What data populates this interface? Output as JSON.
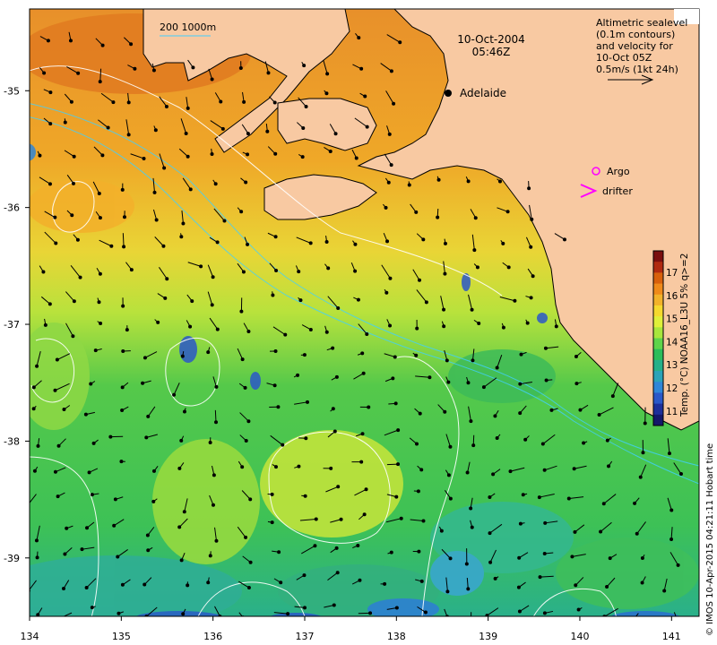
{
  "title": {
    "date": "10-Oct-2004",
    "time": "05:46Z"
  },
  "contour_legend": "200  1000m",
  "city": "Adelaide",
  "altimetry_note": {
    "lines": [
      "Altimetric sealevel",
      "(0.1m contours)",
      "and velocity for",
      "10-Oct 05Z",
      "0.5m/s (1kt 24h)"
    ]
  },
  "legend_items": {
    "argo": "Argo",
    "drifter": "drifter"
  },
  "colorbar": {
    "title": "Temp. (°C) NOAA16_L3U 5% q>=2",
    "ticks": [
      "17",
      "16",
      "15",
      "14",
      "13",
      "12",
      "11"
    ],
    "colors": [
      "#7a0f0f",
      "#b02a10",
      "#d8600c",
      "#ef8a1a",
      "#f2b22a",
      "#f5d92e",
      "#dff03a",
      "#a8e63c",
      "#5ed44a",
      "#2bbd5a",
      "#24b08a",
      "#2aa3b8",
      "#2f86d8",
      "#2b58c8",
      "#1e2f9a",
      "#14186a"
    ]
  },
  "credit": "© IMOS 10-Apr-2015 04:21:11 Hobart time",
  "axes": {
    "x_ticks": [
      "134",
      "135",
      "136",
      "137",
      "138",
      "139",
      "140",
      "141"
    ],
    "y_ticks": [
      "-35",
      "-36",
      "-37",
      "-38",
      "-39"
    ],
    "lon_range": [
      134,
      141.3
    ],
    "lat_range": [
      -39.5,
      -34.3
    ]
  },
  "colors": {
    "land": "#f8c9a2",
    "warm_water": "#eea22a",
    "mid_water": "#dfe53c",
    "cool_water": "#45c84a",
    "cold_water": "#2fb08e"
  }
}
